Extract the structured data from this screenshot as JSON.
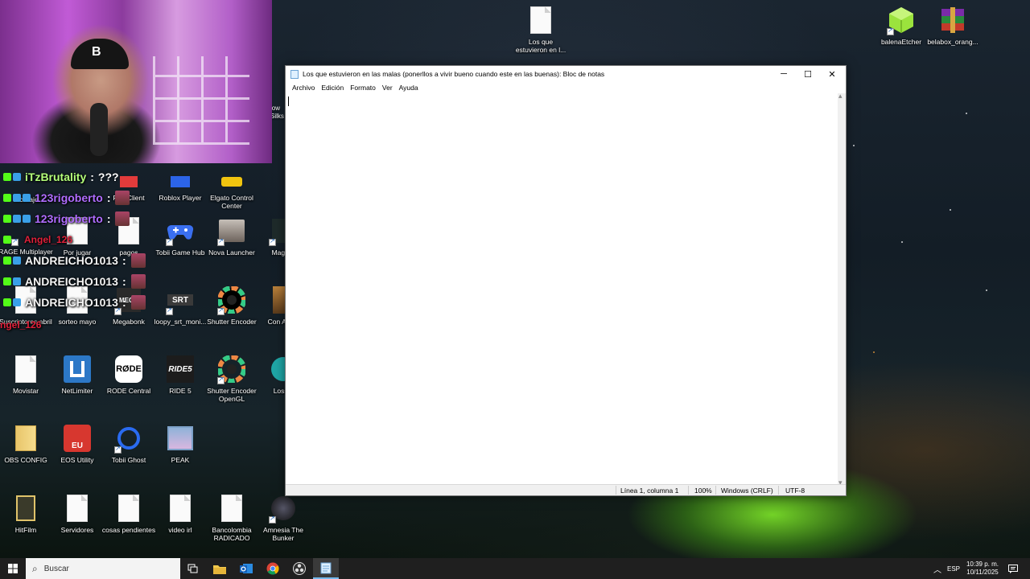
{
  "desktop": {
    "icons": {
      "los_que": "Los que estuvieron en l...",
      "balena": "balenaEtcher",
      "belabox": "belabox_orang...",
      "reciclaje": "reciclaje",
      "riot": "Riot Client",
      "roblox": "Roblox Player",
      "elgato": "Elgato Control Center",
      "rage": "RAGE Multiplayer",
      "porjugar": "Por jugar",
      "pagos": "pagos",
      "tobii_hub": "Tobii Game Hub",
      "nova": "Nova Launcher",
      "mage": "Mage A",
      "suscriptores": "Suscriptores abril",
      "sorteo": "sorteo mayo",
      "megabonk": "Megabonk",
      "loopy": "loopy_srt_moni...",
      "shutter": "Shutter Encoder",
      "conanniv": "Con Anniv",
      "movistar": "Movistar",
      "netlimiter": "NetLimiter",
      "rode": "RODE Central",
      "ride5": "RIDE 5",
      "shutter_gl": "Shutter Encoder OpenGL",
      "lossless": "Lossle",
      "obs": "OBS CONFIG",
      "eos": "EOS Utility",
      "tobii_ghost": "Tobii Ghost",
      "peak": "PEAK",
      "hitfilm": "HitFilm",
      "servidores": "Servidores",
      "cosas": "cosas pendientes",
      "videoirl": "video irl",
      "bancolombia": "Bancolombia RADICADO",
      "amnesia": "Amnesia The Bunker",
      "partial_low": "low Silks"
    }
  },
  "webcam": {
    "cap_letter": "B"
  },
  "chat": [
    {
      "name": "iTzBrutality",
      "sep": ":",
      "extra": "???",
      "color": "#b4ff7a"
    },
    {
      "name": "123rigoberto",
      "sep": ":",
      "color": "#b06cff"
    },
    {
      "name": "123rigoberto",
      "sep": ":",
      "color": "#b06cff"
    },
    {
      "name": "Angel_126",
      "sep": "",
      "color": "#e0203a"
    },
    {
      "name": "ANDREICHO1013",
      "sep": ":",
      "color": "#f4f4f4"
    },
    {
      "name": "ANDREICHO1013",
      "sep": ":",
      "color": "#f4f4f4"
    },
    {
      "name": "ANDREICHO1013",
      "sep": ":",
      "color": "#f4f4f4"
    },
    {
      "name": "ngel_126",
      "sep": "",
      "color": "#e0203a"
    }
  ],
  "notepad": {
    "title": "Los que estuvieron en las malas (ponerllos a vivir bueno cuando este en las buenas): Bloc de notas",
    "menu": [
      "Archivo",
      "Edición",
      "Formato",
      "Ver",
      "Ayuda"
    ],
    "content": "",
    "status": {
      "position": "Línea 1, columna 1",
      "zoom": "100%",
      "line_ending": "Windows (CRLF)",
      "encoding": "UTF-8"
    }
  },
  "taskbar": {
    "search_placeholder": "Buscar",
    "tray": {
      "language": "ESP",
      "time": "10:39 p. m.",
      "date": "10/11/2025"
    }
  },
  "colors": {
    "accent": "#76b9ed",
    "taskbar": "#1f1f1f"
  }
}
